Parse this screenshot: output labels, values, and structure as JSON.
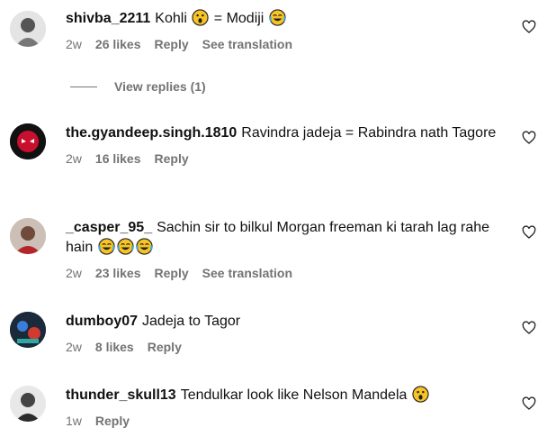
{
  "comments": [
    {
      "username": "shivba_2211",
      "text_parts": [
        "Kohli",
        "= Modiji"
      ],
      "time": "2w",
      "likes": "26 likes",
      "reply": "Reply",
      "translate": "See translation"
    },
    {
      "username": "the.gyandeep.singh.1810",
      "text": "Ravindra jadeja = Rabindra nath Tagore",
      "time": "2w",
      "likes": "16 likes",
      "reply": "Reply"
    },
    {
      "username": "_casper_95_",
      "text": "Sachin sir to bilkul Morgan freeman ki tarah lag rahe hain",
      "time": "2w",
      "likes": "23 likes",
      "reply": "Reply",
      "translate": "See translation"
    },
    {
      "username": "dumboy07",
      "text": "Jadeja to Tagor",
      "time": "2w",
      "likes": "8 likes",
      "reply": "Reply"
    },
    {
      "username": "thunder_skull13",
      "text": "Tendulkar look like Nelson Mandela",
      "time": "1w",
      "reply": "Reply"
    }
  ],
  "view_replies": "View replies (1)",
  "icons": {
    "heart": "heart-outline-icon",
    "surprised": "surprised-face-emoji",
    "laughing": "tears-of-joy-emoji"
  }
}
